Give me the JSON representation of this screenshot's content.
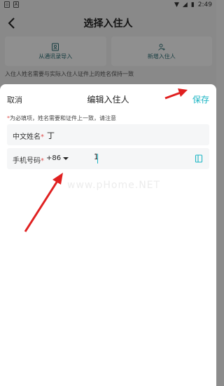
{
  "status_bar": {
    "time": "2:49"
  },
  "nav": {
    "title": "选择入住人"
  },
  "import_options": [
    {
      "label": "从通讯录导入",
      "icon": "contact-book-icon"
    },
    {
      "label": "新增入住人",
      "icon": "add-person-icon"
    }
  ],
  "background_hint": "入住人姓名需要与实际入住人证件上的姓名保持一致",
  "sheet": {
    "cancel_label": "取消",
    "title": "编辑入住人",
    "save_label": "保存",
    "required_note_star": "*",
    "required_note": "为必填项，姓名需要和证件上一致，请注意",
    "name_field": {
      "label": "中文姓名",
      "star": "*",
      "value": "丁"
    },
    "phone_field": {
      "label": "手机号码",
      "star": "*",
      "country_code": "+86",
      "value": "1"
    }
  },
  "watermark": "www.pHome.NET",
  "colors": {
    "accent": "#1cb5c4",
    "required": "#e0514f",
    "annotation": "#e02020"
  }
}
